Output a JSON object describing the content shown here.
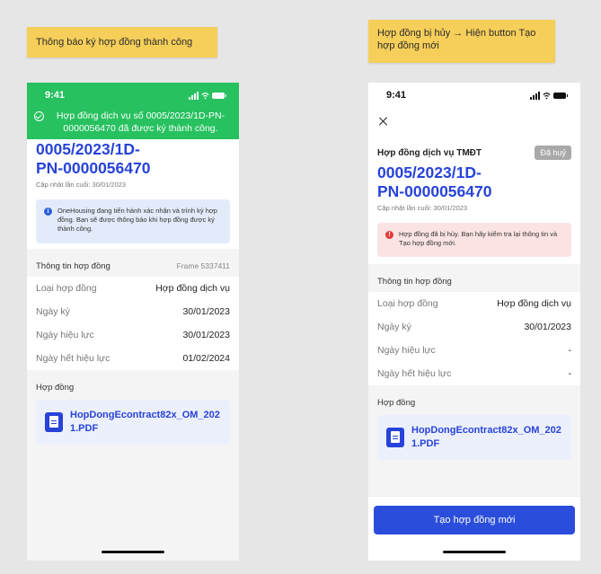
{
  "notes": {
    "left": "Thông báo ký hợp đồng thành công",
    "right": "Hợp đồng bị hủy → Hiện button Tạo hợp đồng mới"
  },
  "left_screen": {
    "time": "9:41",
    "toast": "Hợp đồng dịch vụ số 0005/2023/1D-PN-0000056470 đã được ký thành công.",
    "contract_no_line1": "0005/2023/1D-",
    "contract_no_line2": "PN-0000056470",
    "updated": "Cập nhật lần cuối: 30/01/2023",
    "notice": "OneHousing đang tiến hành xác nhận và trình ký hợp đồng. Bạn sẽ được thông báo khi hợp đồng được ký thành công.",
    "info_header": "Thông tin hợp đồng",
    "frame_label": "Frame 5337411",
    "rows": [
      {
        "label": "Loại hợp đồng",
        "value": "Hợp đồng dịch vụ"
      },
      {
        "label": "Ngày ký",
        "value": "30/01/2023"
      },
      {
        "label": "Ngày hiệu lực",
        "value": "30/01/2023"
      },
      {
        "label": "Ngày hết hiệu lực",
        "value": "01/02/2024"
      }
    ],
    "files_header": "Hợp đồng",
    "file_line1": "HopDongEcontract82x_OM_202",
    "file_line2": "1.PDF"
  },
  "right_screen": {
    "time": "9:41",
    "title": "Hợp đồng dịch vụ TMĐT",
    "badge": "Đã huỷ",
    "contract_no_line1": "0005/2023/1D-",
    "contract_no_line2": "PN-0000056470",
    "updated": "Cập nhật lần cuối: 30/01/2023",
    "notice": "Hợp đồng đã bị hủy. Bạn hãy kiểm tra lại thông tin và Tạo hợp đồng mới.",
    "info_header": "Thông tin hợp đồng",
    "rows": [
      {
        "label": "Loại hợp đồng",
        "value": "Hợp đồng dịch vụ"
      },
      {
        "label": "Ngày ký",
        "value": "30/01/2023"
      },
      {
        "label": "Ngày hiệu lực",
        "value": "-"
      },
      {
        "label": "Ngày hết hiệu lực",
        "value": "-"
      }
    ],
    "files_header": "Hợp đồng",
    "file_line1": "HopDongEcontract82x_OM_202",
    "file_line2": "1.PDF",
    "button": "Tạo hợp đồng mới"
  }
}
